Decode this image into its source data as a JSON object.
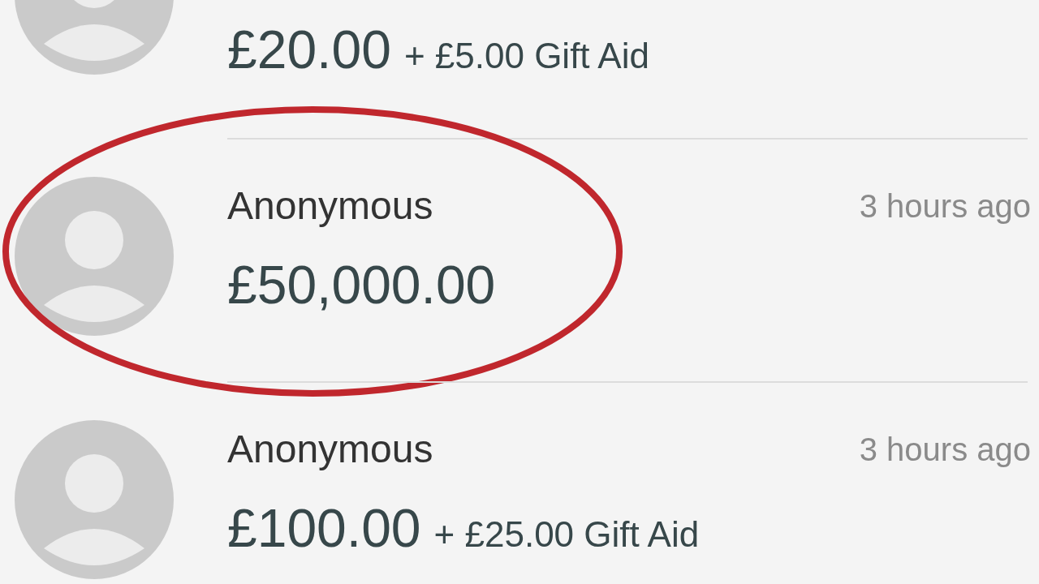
{
  "donations": [
    {
      "amount": "£20.00",
      "gift_aid": "+ £5.00 Gift Aid",
      "highlighted": false
    },
    {
      "name": "Anonymous",
      "time": "3 hours ago",
      "amount": "£50,000.00",
      "highlighted": true
    },
    {
      "name": "Anonymous",
      "time": "3 hours ago",
      "amount": "£100.00",
      "gift_aid": "+ £25.00 Gift Aid",
      "highlighted": false
    }
  ]
}
